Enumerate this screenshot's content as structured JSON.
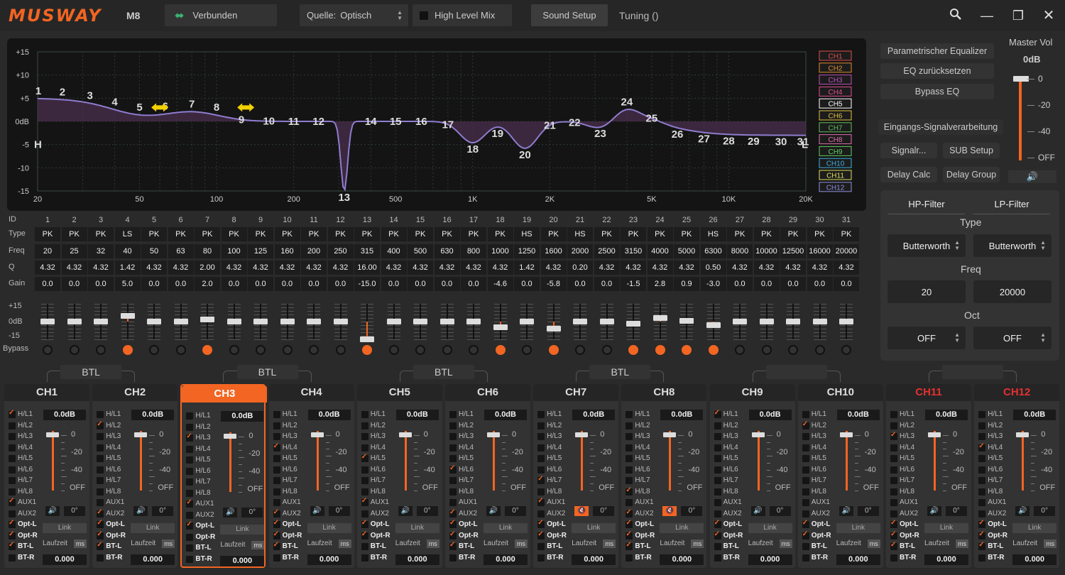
{
  "app": {
    "logo": "MUSWAY",
    "model": "M8",
    "connection": "Verbunden",
    "source_label": "Quelle:",
    "source_value": "Optisch",
    "high_level_mix": "High Level Mix",
    "sound_setup": "Sound Setup",
    "tuning": "Tuning ()"
  },
  "graph": {
    "y_ticks": [
      "+15",
      "+10",
      "+5",
      "0dB",
      "-5",
      "-10",
      "-15"
    ],
    "x_ticks": [
      "20",
      "50",
      "100",
      "200",
      "500",
      "1K",
      "2K",
      "5K",
      "10K",
      "20K"
    ],
    "hp_marker": "H",
    "lp_marker": "L",
    "band_numbers": [
      "1",
      "2",
      "3",
      "4",
      "5",
      "6",
      "7",
      "8",
      "9",
      "10",
      "11",
      "12",
      "13",
      "14",
      "15",
      "16",
      "17",
      "18",
      "19",
      "20",
      "21",
      "22",
      "23",
      "24",
      "25",
      "26",
      "27",
      "28",
      "29",
      "30",
      "31"
    ]
  },
  "channel_legend": [
    "CH1",
    "CH2",
    "CH3",
    "CH4",
    "CH5",
    "CH6",
    "CH7",
    "CH8",
    "CH9",
    "CH10",
    "CH11",
    "CH12"
  ],
  "channel_legend_colors": [
    "#e05050",
    "#e09030",
    "#c050c0",
    "#e05090",
    "#ffffff",
    "#e0c040",
    "#60c060",
    "#e070b0",
    "#60d060",
    "#40b0e0",
    "#e0e060",
    "#9090e0"
  ],
  "right_panel": {
    "param_eq": "Parametrischer Equalizer",
    "eq_reset": "EQ zurücksetzen",
    "bypass_eq": "Bypass EQ",
    "input_processing": "Eingangs-Signalverarbeitung",
    "signal": "Signalr...",
    "sub_setup": "SUB Setup",
    "delay_calc": "Delay Calc",
    "delay_group": "Delay Group",
    "master_vol_label": "Master Vol",
    "master_vol_value": "0dB",
    "master_scale": [
      "0",
      "-20",
      "-40",
      "OFF"
    ]
  },
  "filter": {
    "hp_tab": "HP-Filter",
    "lp_tab": "LP-Filter",
    "type_label": "Type",
    "hp_type": "Butterworth",
    "lp_type": "Butterworth",
    "freq_label": "Freq",
    "hp_freq": "20",
    "lp_freq": "20000",
    "oct_label": "Oct",
    "hp_oct": "OFF",
    "lp_oct": "OFF"
  },
  "eq_table": {
    "row_labels": [
      "ID",
      "Type",
      "Freq",
      "Q",
      "Gain"
    ],
    "ids": [
      "1",
      "2",
      "3",
      "4",
      "5",
      "6",
      "7",
      "8",
      "9",
      "10",
      "11",
      "12",
      "13",
      "14",
      "15",
      "16",
      "17",
      "18",
      "19",
      "20",
      "21",
      "22",
      "23",
      "24",
      "25",
      "26",
      "27",
      "28",
      "29",
      "30",
      "31"
    ],
    "types": [
      "PK",
      "PK",
      "PK",
      "LS",
      "PK",
      "PK",
      "PK",
      "PK",
      "PK",
      "PK",
      "PK",
      "PK",
      "PK",
      "PK",
      "PK",
      "PK",
      "PK",
      "PK",
      "HS",
      "PK",
      "HS",
      "PK",
      "PK",
      "PK",
      "PK",
      "HS",
      "PK",
      "PK",
      "PK",
      "PK",
      "PK"
    ],
    "freqs": [
      "20",
      "25",
      "32",
      "40",
      "50",
      "63",
      "80",
      "100",
      "125",
      "160",
      "200",
      "250",
      "315",
      "400",
      "500",
      "630",
      "800",
      "1000",
      "1250",
      "1600",
      "2000",
      "2500",
      "3150",
      "4000",
      "5000",
      "6300",
      "8000",
      "10000",
      "12500",
      "16000",
      "20000"
    ],
    "qs": [
      "4.32",
      "4.32",
      "4.32",
      "1.42",
      "4.32",
      "4.32",
      "2.00",
      "4.32",
      "4.32",
      "4.32",
      "4.32",
      "4.32",
      "16.00",
      "4.32",
      "4.32",
      "4.32",
      "4.32",
      "4.32",
      "1.42",
      "4.32",
      "0.20",
      "4.32",
      "4.32",
      "4.32",
      "4.32",
      "0.50",
      "4.32",
      "4.32",
      "4.32",
      "4.32",
      "4.32"
    ],
    "gains": [
      "0.0",
      "0.0",
      "0.0",
      "5.0",
      "0.0",
      "0.0",
      "2.0",
      "0.0",
      "0.0",
      "0.0",
      "0.0",
      "0.0",
      "-15.0",
      "0.0",
      "0.0",
      "0.0",
      "0.0",
      "-4.6",
      "0.0",
      "-5.8",
      "0.0",
      "0.0",
      "-1.5",
      "2.8",
      "0.9",
      "-3.0",
      "0.0",
      "0.0",
      "0.0",
      "0.0",
      "0.0"
    ],
    "gain_values": [
      0,
      0,
      0,
      5,
      0,
      0,
      2,
      0,
      0,
      0,
      0,
      0,
      -15,
      0,
      0,
      0,
      0,
      -4.6,
      0,
      -5.8,
      0,
      0,
      -1.5,
      2.8,
      0.9,
      -3,
      0,
      0,
      0,
      0,
      0
    ],
    "bypass_on": [
      false,
      false,
      false,
      true,
      false,
      false,
      true,
      false,
      false,
      false,
      false,
      false,
      true,
      false,
      false,
      false,
      false,
      true,
      false,
      true,
      false,
      false,
      true,
      true,
      true,
      true,
      false,
      false,
      false,
      false,
      false
    ],
    "slider_scale": [
      "+15",
      "0dB",
      "-15"
    ],
    "bypass_label": "Bypass"
  },
  "btl_label": "BTL",
  "channels": [
    {
      "name": "CH1",
      "gain": "0.0dB",
      "red": false,
      "checks": [
        1,
        0,
        0,
        0,
        0,
        0,
        0,
        0,
        1,
        0,
        1,
        1,
        1,
        0
      ],
      "mute": false,
      "phase": "0°",
      "delay": "0.000"
    },
    {
      "name": "CH2",
      "gain": "0.0dB",
      "red": false,
      "checks": [
        0,
        1,
        0,
        0,
        0,
        0,
        0,
        0,
        0,
        1,
        1,
        1,
        1,
        0
      ],
      "mute": false,
      "phase": "0°",
      "delay": "0.000"
    },
    {
      "name": "CH3",
      "gain": "0.0dB",
      "red": false,
      "checks": [
        0,
        0,
        1,
        0,
        0,
        0,
        0,
        0,
        1,
        0,
        1,
        0,
        0,
        0
      ],
      "mute": false,
      "phase": "0°",
      "delay": "0.000"
    },
    {
      "name": "CH4",
      "gain": "0.0dB",
      "red": false,
      "checks": [
        0,
        0,
        0,
        1,
        0,
        0,
        0,
        0,
        0,
        1,
        1,
        1,
        1,
        0
      ],
      "mute": false,
      "phase": "0°",
      "delay": "0.000"
    },
    {
      "name": "CH5",
      "gain": "0.0dB",
      "red": false,
      "checks": [
        0,
        0,
        0,
        0,
        1,
        0,
        0,
        0,
        1,
        0,
        1,
        1,
        0,
        0
      ],
      "mute": false,
      "phase": "0°",
      "delay": "0.000"
    },
    {
      "name": "CH6",
      "gain": "0.0dB",
      "red": false,
      "checks": [
        0,
        0,
        0,
        0,
        0,
        1,
        0,
        0,
        0,
        1,
        1,
        1,
        1,
        0
      ],
      "mute": false,
      "phase": "0°",
      "delay": "0.000"
    },
    {
      "name": "CH7",
      "gain": "0.0dB",
      "red": false,
      "checks": [
        0,
        0,
        0,
        0,
        0,
        0,
        1,
        0,
        1,
        0,
        1,
        1,
        0,
        0
      ],
      "mute": true,
      "phase": "0°",
      "delay": "0.000"
    },
    {
      "name": "CH8",
      "gain": "0.0dB",
      "red": false,
      "checks": [
        0,
        0,
        0,
        0,
        0,
        0,
        0,
        1,
        0,
        1,
        1,
        1,
        1,
        0
      ],
      "mute": true,
      "phase": "0°",
      "delay": "0.000"
    },
    {
      "name": "CH9",
      "gain": "0.0dB",
      "red": false,
      "checks": [
        1,
        0,
        0,
        0,
        0,
        0,
        0,
        0,
        0,
        0,
        1,
        1,
        0,
        0
      ],
      "mute": false,
      "phase": "0°",
      "delay": "0.000"
    },
    {
      "name": "CH10",
      "gain": "0.0dB",
      "red": false,
      "checks": [
        0,
        1,
        0,
        0,
        0,
        0,
        0,
        0,
        0,
        0,
        1,
        1,
        0,
        0
      ],
      "mute": false,
      "phase": "0°",
      "delay": "0.000"
    },
    {
      "name": "CH11",
      "gain": "0.0dB",
      "red": true,
      "checks": [
        0,
        0,
        1,
        0,
        0,
        0,
        0,
        0,
        0,
        0,
        1,
        1,
        1,
        0
      ],
      "mute": false,
      "phase": "0°",
      "delay": "0.000"
    },
    {
      "name": "CH12",
      "gain": "0.0dB",
      "red": true,
      "checks": [
        0,
        0,
        0,
        1,
        0,
        0,
        0,
        0,
        0,
        0,
        1,
        1,
        1,
        0
      ],
      "mute": false,
      "phase": "0°",
      "delay": "0.000"
    }
  ],
  "channel_inputs": [
    "H/L1",
    "H/L2",
    "H/L3",
    "H/L4",
    "H/L5",
    "H/L6",
    "H/L7",
    "H/L8",
    "AUX1",
    "AUX2",
    "Opt-L",
    "Opt-R",
    "BT-L",
    "BT-R"
  ],
  "channel_scale": [
    "0",
    "-20",
    "-40",
    "OFF"
  ],
  "channel_link": "Link",
  "channel_laufzeit": "Laufzeit",
  "channel_ms": "ms",
  "colors": {
    "accent": "#f26522",
    "curve": "#8e7ccf",
    "red_label": "#e53030"
  }
}
